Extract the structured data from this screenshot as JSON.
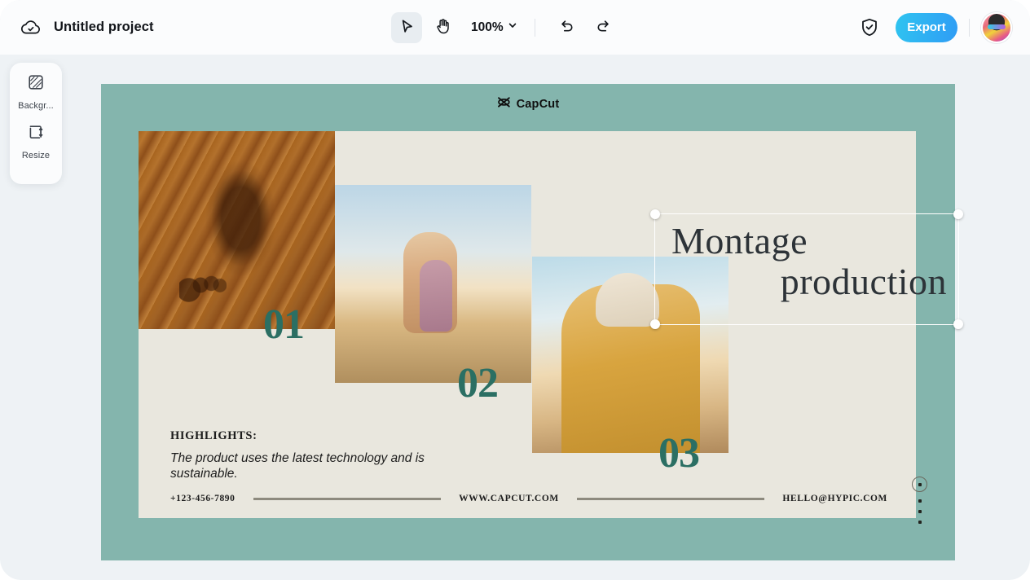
{
  "topbar": {
    "cloud_icon": "cloud-check-icon",
    "project_title": "Untitled project",
    "select_tool_icon": "cursor-arrow-icon",
    "hand_tool_icon": "hand-icon",
    "zoom_value": "100%",
    "zoom_chevron_icon": "chevron-down-icon",
    "undo_icon": "undo-icon",
    "redo_icon": "redo-icon",
    "shield_icon": "shield-check-icon",
    "export_label": "Export",
    "avatar_icon": "user-avatar",
    "export_gradient_from": "#2fc4f0",
    "export_gradient_to": "#2f9cf5"
  },
  "sidebar": {
    "items": [
      {
        "label": "Backgr...",
        "icon": "background-hatched-square-icon"
      },
      {
        "label": "Resize",
        "icon": "resize-crop-icon"
      }
    ]
  },
  "canvas": {
    "slide_background": "#84b5ad",
    "card_background": "#e9e7de",
    "accent_color": "#2b6f63",
    "brand": {
      "logo_icon": "capcut-logo-icon",
      "name": "CapCut"
    },
    "title": {
      "line1": "Montage",
      "line2": "production",
      "selected": true
    },
    "numbers": [
      "01",
      "02",
      "03"
    ],
    "photos": [
      {
        "name": "photo-footprint-in-sand"
      },
      {
        "name": "photo-mother-and-child-on-beach"
      },
      {
        "name": "photo-two-women-at-sunset"
      }
    ],
    "highlights": {
      "title": "HIGHLIGHTS:",
      "body": "The product uses the latest technology and is sustainable."
    },
    "footer": {
      "phone": "+123-456-7890",
      "website": "WWW.CAPCUT.COM",
      "email": "HELLO@HYPIC.COM"
    },
    "pagination": {
      "active_icon": "circled-dot-icon",
      "dot_count": 3
    }
  }
}
